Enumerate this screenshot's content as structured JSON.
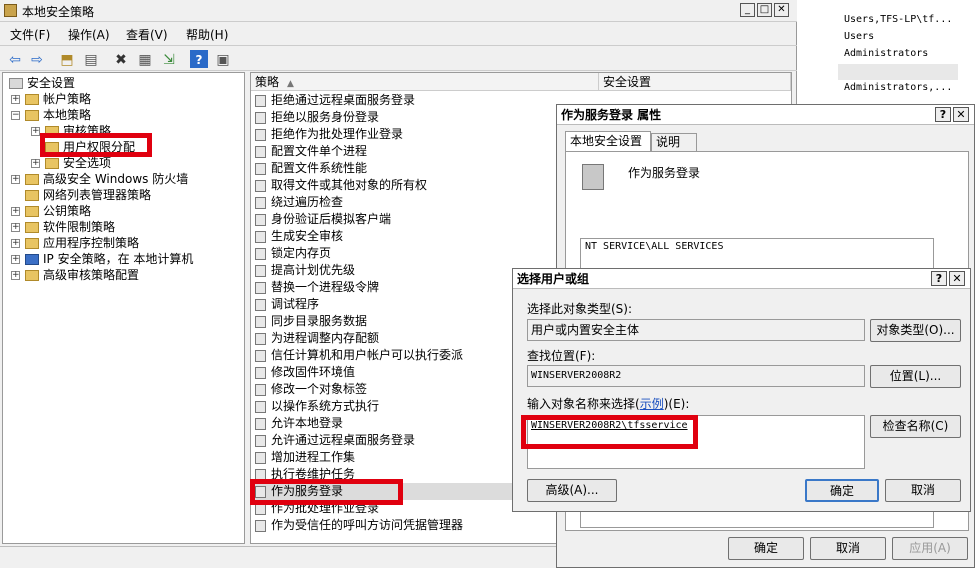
{
  "main": {
    "title": "本地安全策略",
    "menu": [
      "文件(F)",
      "操作(A)",
      "查看(V)",
      "帮助(H)"
    ],
    "tree": {
      "root": "安全设置",
      "items": [
        "帐户策略",
        "本地策略",
        "审核策略",
        "用户权限分配",
        "安全选项",
        "高级安全 Windows 防火墙",
        "网络列表管理器策略",
        "公钥策略",
        "软件限制策略",
        "应用程序控制策略",
        "IP 安全策略，在 本地计算机",
        "高级审核策略配置"
      ]
    },
    "list": {
      "col_policy": "策略",
      "col_setting": "安全设置",
      "rows": [
        "拒绝通过远程桌面服务登录",
        "拒绝以服务身份登录",
        "拒绝作为批处理作业登录",
        "配置文件单个进程",
        "配置文件系统性能",
        "取得文件或其他对象的所有权",
        "绕过遍历检查",
        "身份验证后模拟客户端",
        "生成安全审核",
        "锁定内存页",
        "提高计划优先级",
        "替换一个进程级令牌",
        "调试程序",
        "同步目录服务数据",
        "为进程调整内存配额",
        "信任计算机和用户帐户可以执行委派",
        "修改固件环境值",
        "修改一个对象标签",
        "以操作系统方式执行",
        "允许本地登录",
        "允许通过远程桌面服务登录",
        "增加进程工作集",
        "执行卷维护任务",
        "作为服务登录",
        "作为批处理作业登录",
        "作为受信任的呼叫方访问凭据管理器"
      ]
    }
  },
  "right_panel": [
    "Users,TFS-LP\\tf...",
    "Users",
    "Administrators",
    "Administrators,..."
  ],
  "props": {
    "title": "作为服务登录 属性",
    "tabs": [
      "本地安全设置",
      "说明"
    ],
    "policy_name": "作为服务登录",
    "members": [
      "NT SERVICE\\ALL SERVICES"
    ],
    "ok": "确定",
    "cancel": "取消",
    "apply": "应用(A)"
  },
  "select": {
    "title": "选择用户或组",
    "type_label": "选择此对象类型(S):",
    "type_value": "用户或内置安全主体",
    "type_btn": "对象类型(O)...",
    "loc_label": "查找位置(F):",
    "loc_value": "WINSERVER2008R2",
    "loc_btn": "位置(L)...",
    "name_label_a": "输入对象名称来选择(",
    "name_label_link": "示例",
    "name_label_b": ")(E):",
    "name_value": "WINSERVER2008R2\\tfsservice",
    "check_btn": "检查名称(C)",
    "advanced_btn": "高级(A)...",
    "ok": "确定",
    "cancel": "取消"
  }
}
